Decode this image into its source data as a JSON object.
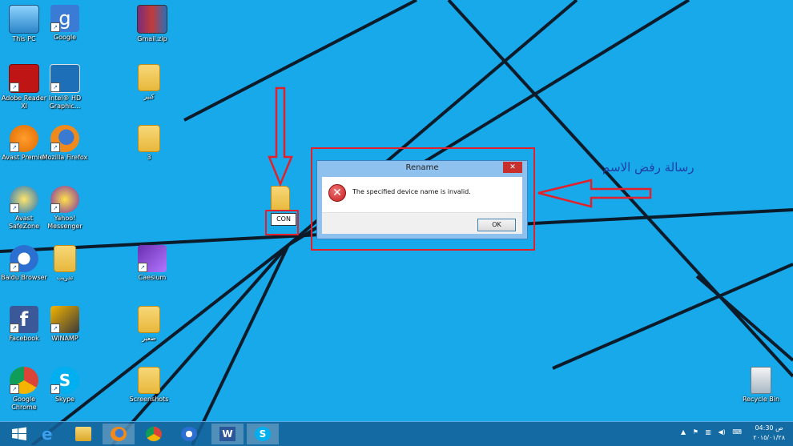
{
  "desktop_icons": [
    {
      "label": "This PC",
      "icon": "this-pc-icon"
    },
    {
      "label": "Google",
      "icon": "google-icon"
    },
    {
      "label": "Gmail.zip",
      "icon": "winrar-archive-icon"
    },
    {
      "label": "Adobe Reader XI",
      "icon": "adobe-reader-icon"
    },
    {
      "label": "Intel® HD Graphic...",
      "icon": "intel-graphics-icon"
    },
    {
      "label": "كبير",
      "icon": "folder-icon"
    },
    {
      "label": "Avast Premier",
      "icon": "avast-icon"
    },
    {
      "label": "Mozilla Firefox",
      "icon": "firefox-icon"
    },
    {
      "label": "3",
      "icon": "folder-icon"
    },
    {
      "label": "Avast SafeZone",
      "icon": "avast-safezone-icon"
    },
    {
      "label": "Yahoo! Messenger",
      "icon": "yahoo-messenger-icon"
    },
    {
      "label": "Baidu Browser",
      "icon": "baidu-browser-icon"
    },
    {
      "label": "تدريب",
      "icon": "folder-icon"
    },
    {
      "label": "Caesium",
      "icon": "caesium-icon"
    },
    {
      "label": "Facebook",
      "icon": "facebook-icon"
    },
    {
      "label": "WINAMP",
      "icon": "winamp-icon"
    },
    {
      "label": "صغير",
      "icon": "folder-icon"
    },
    {
      "label": "Google Chrome",
      "icon": "chrome-icon"
    },
    {
      "label": "Skype",
      "icon": "skype-icon"
    },
    {
      "label": "Screenshots",
      "icon": "folder-icon"
    },
    {
      "label": "Recycle Bin",
      "icon": "recycle-bin-icon"
    }
  ],
  "renaming_folder": {
    "label": "CON"
  },
  "dialog": {
    "title": "Rename",
    "close_label": "✕",
    "message": "The specified device name is invalid.",
    "ok_label": "OK"
  },
  "annotation": "رسالة رفض الاسم",
  "taskbar": {
    "items": [
      "start",
      "internet-explorer",
      "file-explorer",
      "firefox",
      "chrome",
      "baidu",
      "word",
      "skype"
    ],
    "active": "firefox"
  },
  "clock": {
    "ampm": "ص",
    "time": "04:30",
    "date": "٢٠١٥/٠١/٢٨"
  },
  "colors": {
    "desktop": "#16a7e9",
    "annotation_red": "#e4202a",
    "dialog_frame": "#8fc1ee"
  }
}
